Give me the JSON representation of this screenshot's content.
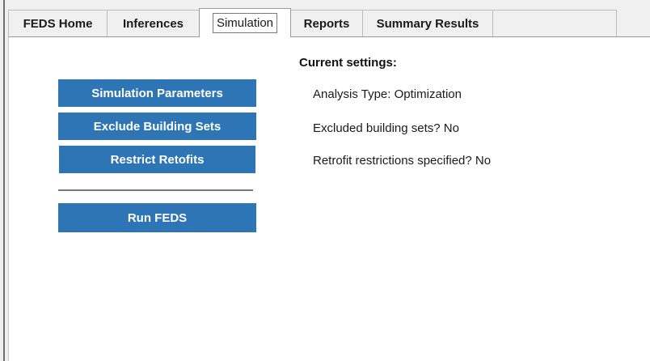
{
  "tabs": [
    {
      "label": "FEDS Home",
      "active": false
    },
    {
      "label": "Inferences",
      "active": false
    },
    {
      "label": "Simulation",
      "active": true
    },
    {
      "label": "Reports",
      "active": false
    },
    {
      "label": "Summary Results",
      "active": false
    }
  ],
  "buttons": {
    "simulation_parameters": "Simulation Parameters",
    "exclude_building_sets": "Exclude Building Sets",
    "restrict_retrofits": "Restrict Retofits",
    "run_feds": "Run FEDS"
  },
  "settings": {
    "title": "Current settings:",
    "analysis_type": "Analysis Type:  Optimization",
    "excluded_building_sets": "Excluded building sets?  No",
    "retrofit_restrictions": "Retrofit restrictions specified?  No"
  },
  "colors": {
    "button_bg": "#2e75b6",
    "button_text": "#ffffff",
    "panel_bg": "#ffffff",
    "window_bg": "#f0f0f0"
  }
}
